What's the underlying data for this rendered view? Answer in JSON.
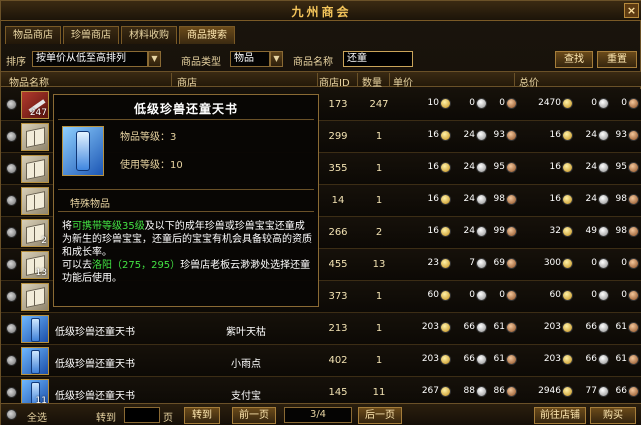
{
  "window": {
    "title": "九州商会",
    "close": "×"
  },
  "tabs": [
    "物品商店",
    "珍兽商店",
    "材料收购",
    "商品搜索"
  ],
  "filter": {
    "sort_label": "排序",
    "sort_value": "按单价从低至高排列",
    "type_label": "商品类型",
    "type_value": "物品",
    "name_label": "商品名称",
    "name_value": "还童",
    "search_button": "查找",
    "reset_button": "重置"
  },
  "columns": [
    "物品名称",
    "商店",
    "商店ID",
    "数量",
    "单价",
    "总价"
  ],
  "rows": [
    {
      "icon": "red",
      "qty_badge": "247",
      "name": "",
      "shop": "",
      "shop_id": "173",
      "count": "247",
      "unit": [
        "10",
        "0",
        "0"
      ],
      "total": [
        "2470",
        "0",
        "0"
      ]
    },
    {
      "icon": "book",
      "qty_badge": "",
      "name": "",
      "shop": "",
      "shop_id": "299",
      "count": "1",
      "unit": [
        "16",
        "24",
        "93"
      ],
      "total": [
        "16",
        "24",
        "93"
      ]
    },
    {
      "icon": "book",
      "qty_badge": "",
      "name": "",
      "shop": "",
      "shop_id": "355",
      "count": "1",
      "unit": [
        "16",
        "24",
        "95"
      ],
      "total": [
        "16",
        "24",
        "95"
      ]
    },
    {
      "icon": "book",
      "qty_badge": "",
      "name": "",
      "shop": "",
      "shop_id": "14",
      "count": "1",
      "unit": [
        "16",
        "24",
        "98"
      ],
      "total": [
        "16",
        "24",
        "98"
      ]
    },
    {
      "icon": "book",
      "qty_badge": "2",
      "name": "",
      "shop": "",
      "shop_id": "266",
      "count": "2",
      "unit": [
        "16",
        "24",
        "99"
      ],
      "total": [
        "32",
        "49",
        "98"
      ]
    },
    {
      "icon": "book",
      "qty_badge": "13",
      "name": "",
      "shop": "",
      "shop_id": "455",
      "count": "13",
      "unit": [
        "23",
        "7",
        "69"
      ],
      "total": [
        "300",
        "0",
        "0"
      ]
    },
    {
      "icon": "book",
      "qty_badge": "",
      "name": "",
      "shop": "",
      "shop_id": "373",
      "count": "1",
      "unit": [
        "60",
        "0",
        "0"
      ],
      "total": [
        "60",
        "0",
        "0"
      ]
    },
    {
      "icon": "blue",
      "qty_badge": "",
      "name": "低级珍兽还童天书",
      "shop": "紫叶天枯",
      "shop_id": "213",
      "count": "1",
      "unit": [
        "203",
        "66",
        "61"
      ],
      "total": [
        "203",
        "66",
        "61"
      ]
    },
    {
      "icon": "blue",
      "qty_badge": "",
      "name": "低级珍兽还童天书",
      "shop": "小雨点",
      "shop_id": "402",
      "count": "1",
      "unit": [
        "203",
        "66",
        "61"
      ],
      "total": [
        "203",
        "66",
        "61"
      ]
    },
    {
      "icon": "blue",
      "qty_badge": "11",
      "name": "低级珍兽还童天书",
      "shop": "支付宝",
      "shop_id": "145",
      "count": "11",
      "unit": [
        "267",
        "88",
        "86"
      ],
      "total": [
        "2946",
        "77",
        "66"
      ]
    }
  ],
  "tooltip": {
    "title": "低级珍兽还童天书",
    "level_label": "物品等级：3",
    "use_level_label": "使用等级：10",
    "category": "特殊物品",
    "desc_1a": "将",
    "desc_1b": "可携带等级35级",
    "desc_1c": "及以下的成年珍兽或珍兽宝宝还童成为新生的珍兽宝宝，还童后的宝宝有机会具备较高的资质和成长率。",
    "desc_2a": "可以去",
    "desc_2b": "洛阳（275，295）",
    "desc_2c": "珍兽店老板云渺渺处选择还童功能后使用。",
    "desc_3": ""
  },
  "footer": {
    "select_all": "全选",
    "goto_label": "转到",
    "page_suffix": "页",
    "goto_button": "转到",
    "prev_button": "前一页",
    "page_indicator": "3/4",
    "next_button": "后一页",
    "shop_button": "前往店铺",
    "buy_button": "购买"
  }
}
